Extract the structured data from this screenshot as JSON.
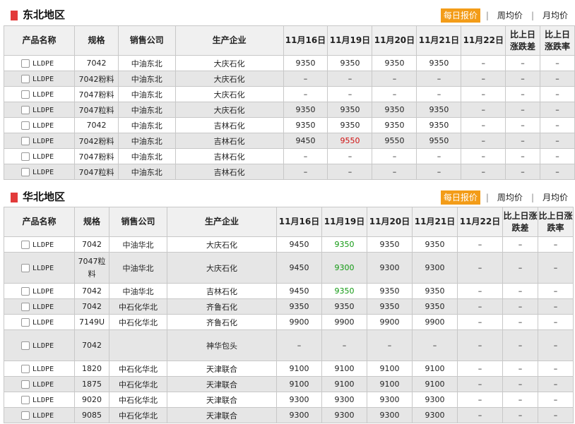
{
  "sections": [
    {
      "title": "东北地区",
      "tabs": [
        "每日报价",
        "周均价",
        "月均价"
      ],
      "headers": [
        "产品名称",
        "规格",
        "销售公司",
        "生产企业",
        "11月16日",
        "11月19日",
        "11月20日",
        "11月21日",
        "11月22日",
        "比上日涨跌差",
        "比上日涨跌率"
      ],
      "rows": [
        {
          "product": "LLDPE",
          "spec": "7042",
          "seller": "中油东北",
          "maker": "大庆石化",
          "p1": "9350",
          "p2": "9350",
          "p3": "9350",
          "p4": "9350",
          "p5": "–",
          "diff": "–",
          "rate": "–"
        },
        {
          "product": "LLDPE",
          "spec": "7042粉料",
          "seller": "中油东北",
          "maker": "大庆石化",
          "p1": "–",
          "p2": "–",
          "p3": "–",
          "p4": "–",
          "p5": "–",
          "diff": "–",
          "rate": "–"
        },
        {
          "product": "LLDPE",
          "spec": "7047粉料",
          "seller": "中油东北",
          "maker": "大庆石化",
          "p1": "–",
          "p2": "–",
          "p3": "–",
          "p4": "–",
          "p5": "–",
          "diff": "–",
          "rate": "–"
        },
        {
          "product": "LLDPE",
          "spec": "7047粒料",
          "seller": "中油东北",
          "maker": "大庆石化",
          "p1": "9350",
          "p2": "9350",
          "p3": "9350",
          "p4": "9350",
          "p5": "–",
          "diff": "–",
          "rate": "–"
        },
        {
          "product": "LLDPE",
          "spec": "7042",
          "seller": "中油东北",
          "maker": "吉林石化",
          "p1": "9350",
          "p2": "9350",
          "p3": "9350",
          "p4": "9350",
          "p5": "–",
          "diff": "–",
          "rate": "–"
        },
        {
          "product": "LLDPE",
          "spec": "7042粉料",
          "seller": "中油东北",
          "maker": "吉林石化",
          "p1": "9450",
          "p2": "9550",
          "p3": "9550",
          "p4": "9550",
          "p5": "–",
          "diff": "–",
          "rate": "–"
        },
        {
          "product": "LLDPE",
          "spec": "7047粉料",
          "seller": "中油东北",
          "maker": "吉林石化",
          "p1": "–",
          "p2": "–",
          "p3": "–",
          "p4": "–",
          "p5": "–",
          "diff": "–",
          "rate": "–"
        },
        {
          "product": "LLDPE",
          "spec": "7047粒料",
          "seller": "中油东北",
          "maker": "吉林石化",
          "p1": "–",
          "p2": "–",
          "p3": "–",
          "p4": "–",
          "p5": "–",
          "diff": "–",
          "rate": "–"
        }
      ],
      "colors": {
        "5-p2": "#d01010"
      }
    },
    {
      "title": "华北地区",
      "tabs": [
        "每日报价",
        "周均价",
        "月均价"
      ],
      "headers": [
        "产品名称",
        "规格",
        "销售公司",
        "生产企业",
        "11月16日",
        "11月19日",
        "11月20日",
        "11月21日",
        "11月22日",
        "比上日涨跌差",
        "比上日涨跌率"
      ],
      "rows": [
        {
          "product": "LLDPE",
          "spec": "7042",
          "seller": "中油华北",
          "maker": "大庆石化",
          "p1": "9450",
          "p2": "9350",
          "p3": "9350",
          "p4": "9350",
          "p5": "–",
          "diff": "–",
          "rate": "–"
        },
        {
          "product": "LLDPE",
          "spec": "7047粒料",
          "seller": "中油华北",
          "maker": "大庆石化",
          "p1": "9450",
          "p2": "9300",
          "p3": "9300",
          "p4": "9300",
          "p5": "–",
          "diff": "–",
          "rate": "–"
        },
        {
          "product": "LLDPE",
          "spec": "7042",
          "seller": "中油华北",
          "maker": "吉林石化",
          "p1": "9450",
          "p2": "9350",
          "p3": "9350",
          "p4": "9350",
          "p5": "–",
          "diff": "–",
          "rate": "–"
        },
        {
          "product": "LLDPE",
          "spec": "7042",
          "seller": "中石化华北",
          "maker": "齐鲁石化",
          "p1": "9350",
          "p2": "9350",
          "p3": "9350",
          "p4": "9350",
          "p5": "–",
          "diff": "–",
          "rate": "–"
        },
        {
          "product": "LLDPE",
          "spec": "7149U",
          "seller": "中石化华北",
          "maker": "齐鲁石化",
          "p1": "9900",
          "p2": "9900",
          "p3": "9900",
          "p4": "9900",
          "p5": "–",
          "diff": "–",
          "rate": "–"
        },
        {
          "product": "LLDPE",
          "spec": "7042",
          "seller": "",
          "maker": "神华包头",
          "p1": "–",
          "p2": "–",
          "p3": "–",
          "p4": "–",
          "p5": "–",
          "diff": "–",
          "rate": "–"
        },
        {
          "product": "LLDPE",
          "spec": "1820",
          "seller": "中石化华北",
          "maker": "天津联合",
          "p1": "9100",
          "p2": "9100",
          "p3": "9100",
          "p4": "9100",
          "p5": "–",
          "diff": "–",
          "rate": "–"
        },
        {
          "product": "LLDPE",
          "spec": "1875",
          "seller": "中石化华北",
          "maker": "天津联合",
          "p1": "9100",
          "p2": "9100",
          "p3": "9100",
          "p4": "9100",
          "p5": "–",
          "diff": "–",
          "rate": "–"
        },
        {
          "product": "LLDPE",
          "spec": "9020",
          "seller": "中石化华北",
          "maker": "天津联合",
          "p1": "9300",
          "p2": "9300",
          "p3": "9300",
          "p4": "9300",
          "p5": "–",
          "diff": "–",
          "rate": "–"
        },
        {
          "product": "LLDPE",
          "spec": "9085",
          "seller": "中石化华北",
          "maker": "天津联合",
          "p1": "9300",
          "p2": "9300",
          "p3": "9300",
          "p4": "9300",
          "p5": "–",
          "diff": "–",
          "rate": "–"
        }
      ],
      "colors": {
        "0-p2": "#119911",
        "1-p2": "#119911",
        "2-p2": "#119911"
      }
    }
  ]
}
